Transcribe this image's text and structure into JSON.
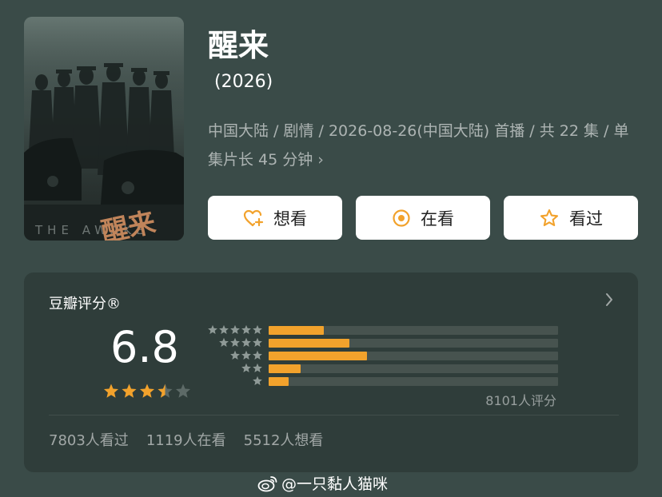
{
  "poster": {
    "en_text": "THE AWAKE",
    "cn_text": "醒来"
  },
  "movie": {
    "title": "醒来",
    "year": "(2026)",
    "meta_line": "中国大陆 / 剧情 / 2026-08-26(中国大陆) 首播 / 共 22 集 / 单集片长 45 分钟",
    "meta_chevron": "›"
  },
  "actions": [
    {
      "label": "想看",
      "icon": "heart-plus-icon"
    },
    {
      "label": "在看",
      "icon": "target-circle-icon"
    },
    {
      "label": "看过",
      "icon": "star-outline-icon"
    }
  ],
  "rating": {
    "title": "豆瓣评分®",
    "score": "6.8",
    "stars_filled": 3.5,
    "stars_total": 5,
    "distribution": [
      {
        "stars": 5,
        "fraction": 0.19
      },
      {
        "stars": 4,
        "fraction": 0.28
      },
      {
        "stars": 3,
        "fraction": 0.34
      },
      {
        "stars": 2,
        "fraction": 0.11
      },
      {
        "stars": 1,
        "fraction": 0.07
      }
    ],
    "total": "8101人评分",
    "stats": [
      "7803人看过",
      "1119人在看",
      "5512人想看"
    ]
  },
  "colors": {
    "background": "#3a4b48",
    "card": "#2f3d3a",
    "accent": "#f2a22c",
    "bar_track": "#47534f"
  },
  "watermark": "@一只黏人猫咪"
}
